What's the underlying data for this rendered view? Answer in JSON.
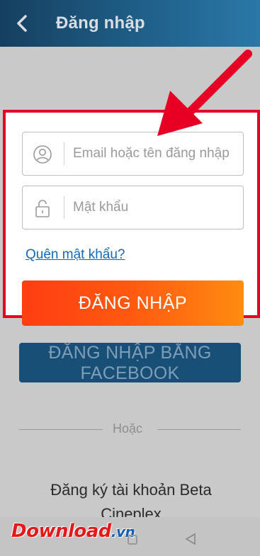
{
  "header": {
    "title": "Đăng nhập",
    "back_icon": "chevron-left-icon",
    "gradient": [
      "#163f5f",
      "#2a78a8"
    ]
  },
  "login_form": {
    "email_placeholder": "Email hoặc tên đăng nhập",
    "email_icon": "user-icon",
    "password_placeholder": "Mật khẩu",
    "password_icon": "lock-icon",
    "forgot_password": "Quên mật khẩu?",
    "login_button": "ĐĂNG NHẬP",
    "highlight_color": "#e60023",
    "button_gradient": [
      "#ff3d12",
      "#ff8c10"
    ]
  },
  "facebook_button": "ĐĂNG NHẬP BẰNG FACEBOOK",
  "divider_text": "Hoặc",
  "register_text": "Đăng ký tài khoản Beta Cineplex",
  "watermark": {
    "brand": "Download",
    "tld": ".vn"
  },
  "annotation_arrow_color": "#e60023"
}
